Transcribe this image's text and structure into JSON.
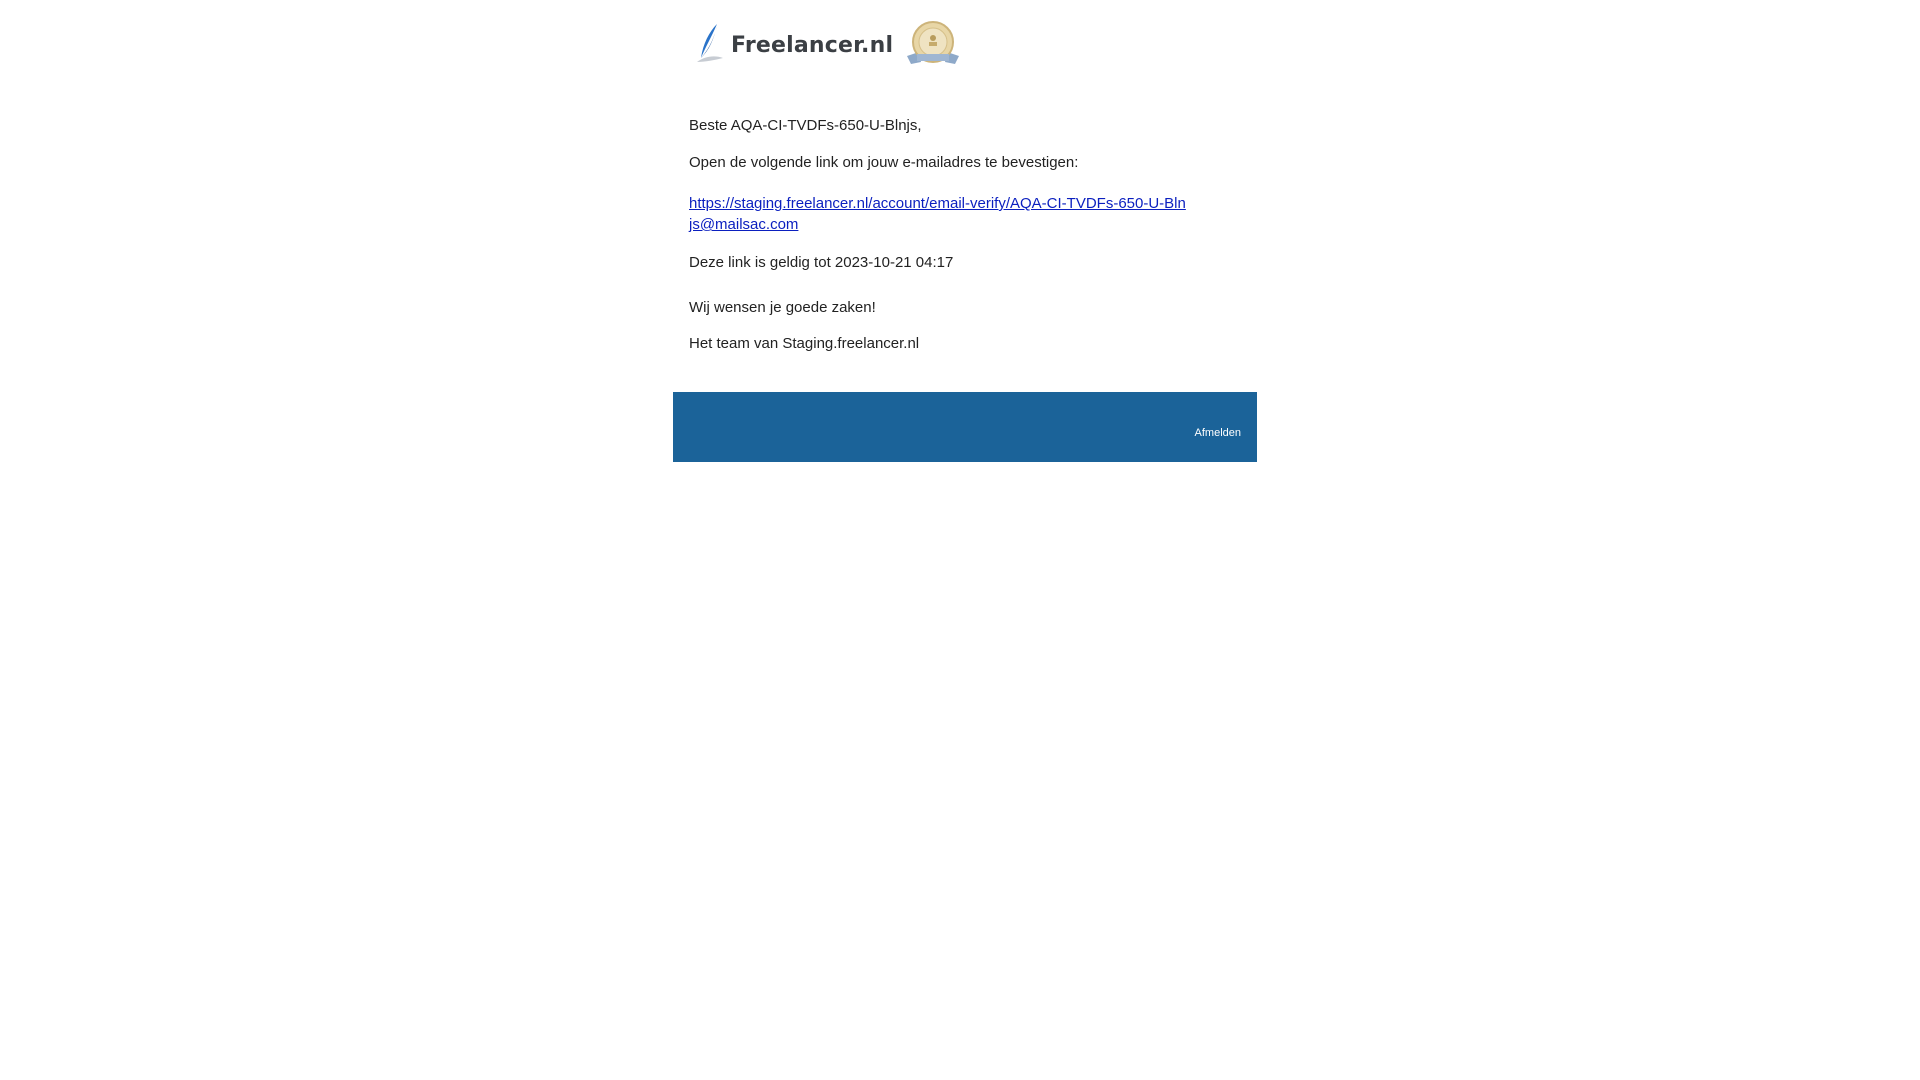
{
  "brand": {
    "logo_text": "Freelancer.nl",
    "logo_color": "#3b3f44",
    "accent_color": "#1b6399",
    "feather_color": "#2a73c9"
  },
  "email": {
    "greeting": "Beste AQA-CI-TVDFs-650-U-Blnjs,",
    "intro": "Open de volgende link om jouw e-mailadres te bevestigen:",
    "verify_link": "https://staging.freelancer.nl/account/email-verify/AQA-CI-TVDFs-650-U-Blnjs@mailsac.com",
    "validity": "Deze link is geldig tot 2023-10-21 04:17",
    "wish": "Wij wensen je goede zaken!",
    "signature": "Het team van Staging.freelancer.nl"
  },
  "footer": {
    "unsubscribe_label": "Afmelden",
    "background": "#1b6399"
  }
}
